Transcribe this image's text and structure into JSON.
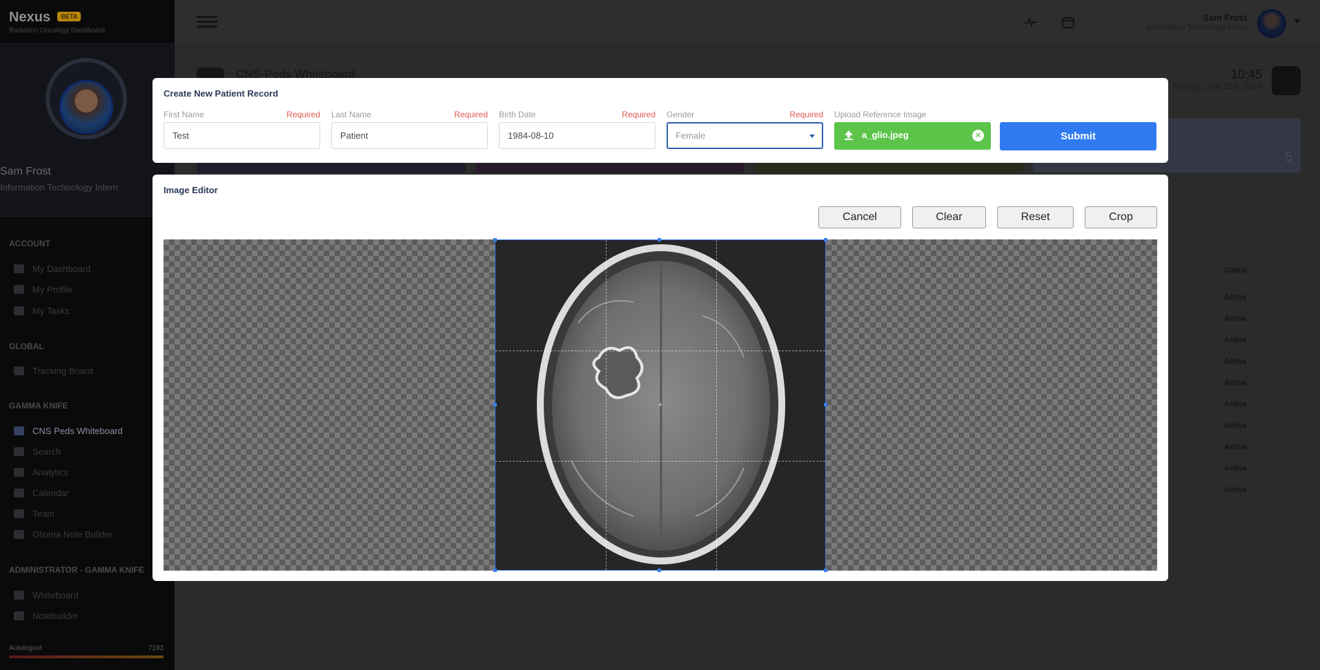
{
  "sidebar": {
    "brand": "Nexus",
    "badge": "BETA",
    "brand_sub": "Radiation Oncology Dashboard",
    "profile_name": "Sam Frost",
    "profile_role": "Information Technology Intern",
    "sections": [
      {
        "title": "ACCOUNT",
        "items": [
          "My Dashboard",
          "My Profile",
          "My Tasks"
        ]
      },
      {
        "title": "GLOBAL",
        "items": [
          "Tracking Board"
        ]
      },
      {
        "title": "GAMMA KNIFE",
        "items": [
          "CNS Peds Whiteboard",
          "Search",
          "Analytics",
          "Calendar",
          "Team",
          "Glioma Note Builder"
        ]
      },
      {
        "title": "ADMINISTRATOR - GAMMA KNIFE",
        "items": [
          "Whiteboard",
          "Notebuilder"
        ]
      }
    ],
    "autologout_label": "Autologout",
    "autologout_value": "7193"
  },
  "header": {
    "user_name": "Sam Frost",
    "user_role": "Information Technology Intern"
  },
  "background_page": {
    "title": "CNS-Peds Whiteboard",
    "time": "10:45",
    "date": "Monday, July 31st, 2023",
    "card_count": "5",
    "status_header": "Status",
    "statuses": [
      "Active",
      "Active",
      "Active",
      "Active",
      "Active",
      "Active",
      "Active",
      "Active",
      "Active",
      "Active"
    ]
  },
  "patient_form": {
    "title": "Create New Patient Record",
    "required_text": "Required",
    "first_name": {
      "label": "First Name",
      "value": "Test"
    },
    "last_name": {
      "label": "Last Name",
      "value": "Patient"
    },
    "birth_date": {
      "label": "Birth Date",
      "value": "1984-08-10"
    },
    "gender": {
      "label": "Gender",
      "value": "Female"
    },
    "upload": {
      "label": "Upload Reference Image",
      "filename": "a_glio.jpeg"
    },
    "submit_label": "Submit"
  },
  "image_editor": {
    "title": "Image Editor",
    "buttons": {
      "cancel": "Cancel",
      "clear": "Clear",
      "reset": "Reset",
      "crop": "Crop"
    }
  },
  "colors": {
    "primary": "#2f7af0",
    "success": "#5bc449",
    "required": "#e0584f",
    "crop_border": "#3a7de8"
  }
}
